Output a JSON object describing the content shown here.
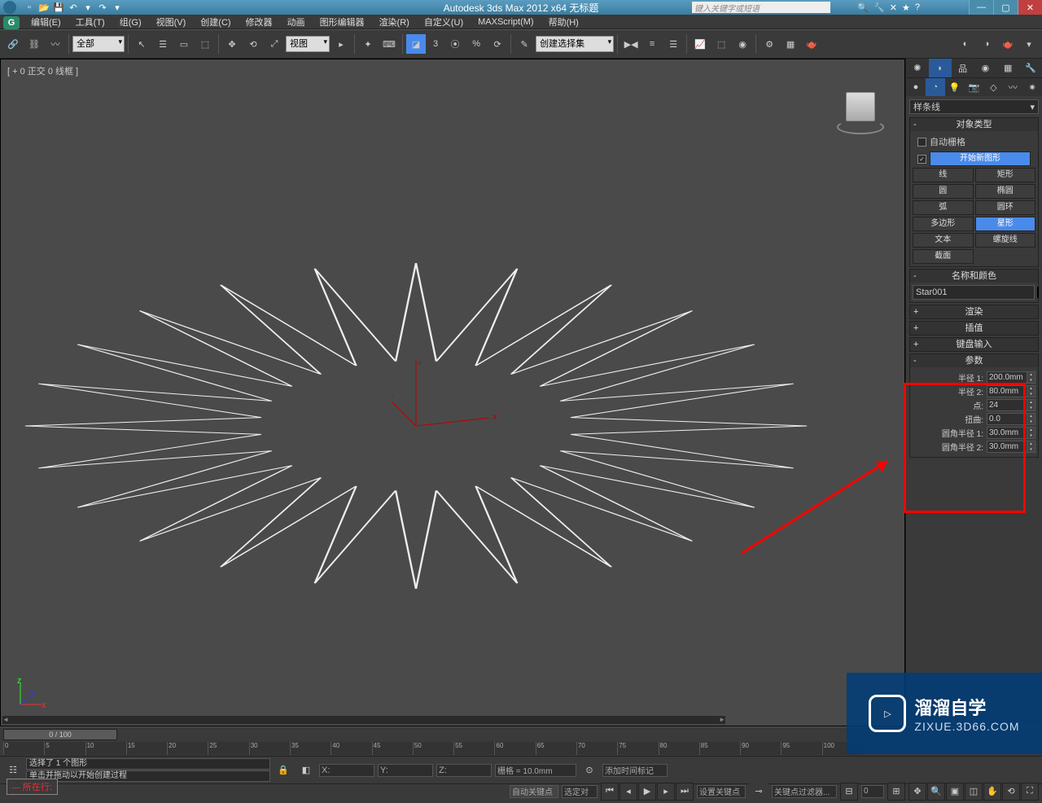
{
  "titlebar": {
    "app_title": "Autodesk 3ds Max  2012 x64    无标题",
    "search_placeholder": "键入关键字或短语"
  },
  "menu": {
    "edit": "编辑(E)",
    "tools": "工具(T)",
    "group": "组(G)",
    "views": "视图(V)",
    "create": "创建(C)",
    "modifiers": "修改器",
    "animation": "动画",
    "graph": "图形编辑器",
    "render": "渲染(R)",
    "custom": "自定义(U)",
    "maxscript": "MAXScript(M)",
    "help": "帮助(H)"
  },
  "toolbar": {
    "all_filter": "全部",
    "view_label": "视图",
    "selset": "创建选择集"
  },
  "viewport": {
    "label": "[ + 0 正交 0 线框 ]"
  },
  "cmdpanel": {
    "dropdown": "样条线",
    "rollout_objtype": "对象类型",
    "auto_grid": "自动栅格",
    "start_new": "开始新图形",
    "btn_line": "线",
    "btn_rect": "矩形",
    "btn_circle": "圆",
    "btn_ellipse": "椭圆",
    "btn_arc": "弧",
    "btn_donut": "圆环",
    "btn_ngon": "多边形",
    "btn_star": "星形",
    "btn_text": "文本",
    "btn_helix": "螺旋线",
    "btn_section": "截面",
    "rollout_name": "名称和颜色",
    "obj_name": "Star001",
    "rollout_render": "渲染",
    "rollout_interp": "插值",
    "rollout_kbd": "键盘输入",
    "rollout_params": "参数",
    "p_radius1_lbl": "半径 1:",
    "p_radius1_val": "200.0mm",
    "p_radius2_lbl": "半径 2:",
    "p_radius2_val": "80.0mm",
    "p_points_lbl": "点:",
    "p_points_val": "24",
    "p_distort_lbl": "扭曲:",
    "p_distort_val": "0.0",
    "p_fillet1_lbl": "圆角半径 1:",
    "p_fillet1_val": "30.0mm",
    "p_fillet2_lbl": "圆角半径 2:",
    "p_fillet2_val": "30.0mm"
  },
  "timeline": {
    "slider": "0 / 100",
    "ticks": [
      "0",
      "5",
      "10",
      "15",
      "20",
      "25",
      "30",
      "35",
      "40",
      "45",
      "50",
      "55",
      "60",
      "65",
      "70",
      "75",
      "80",
      "85",
      "90",
      "95",
      "100"
    ]
  },
  "status": {
    "sel": "选择了 1 个图形",
    "prompt": "单击并拖动以开始创建过程",
    "x": "X:",
    "y": "Y:",
    "z": "Z:",
    "grid": "栅格 = 10.0mm",
    "addtime": "添加时间标记",
    "autokey": "自动关键点",
    "setkey": "设置关键点",
    "selsel": "选定对",
    "keyfilt": "关键点过滤器...",
    "curloc": "所在行:",
    "framefield": "0"
  },
  "watermark": {
    "brand": "溜溜自学",
    "url": "ZIXUE.3D66.COM"
  }
}
